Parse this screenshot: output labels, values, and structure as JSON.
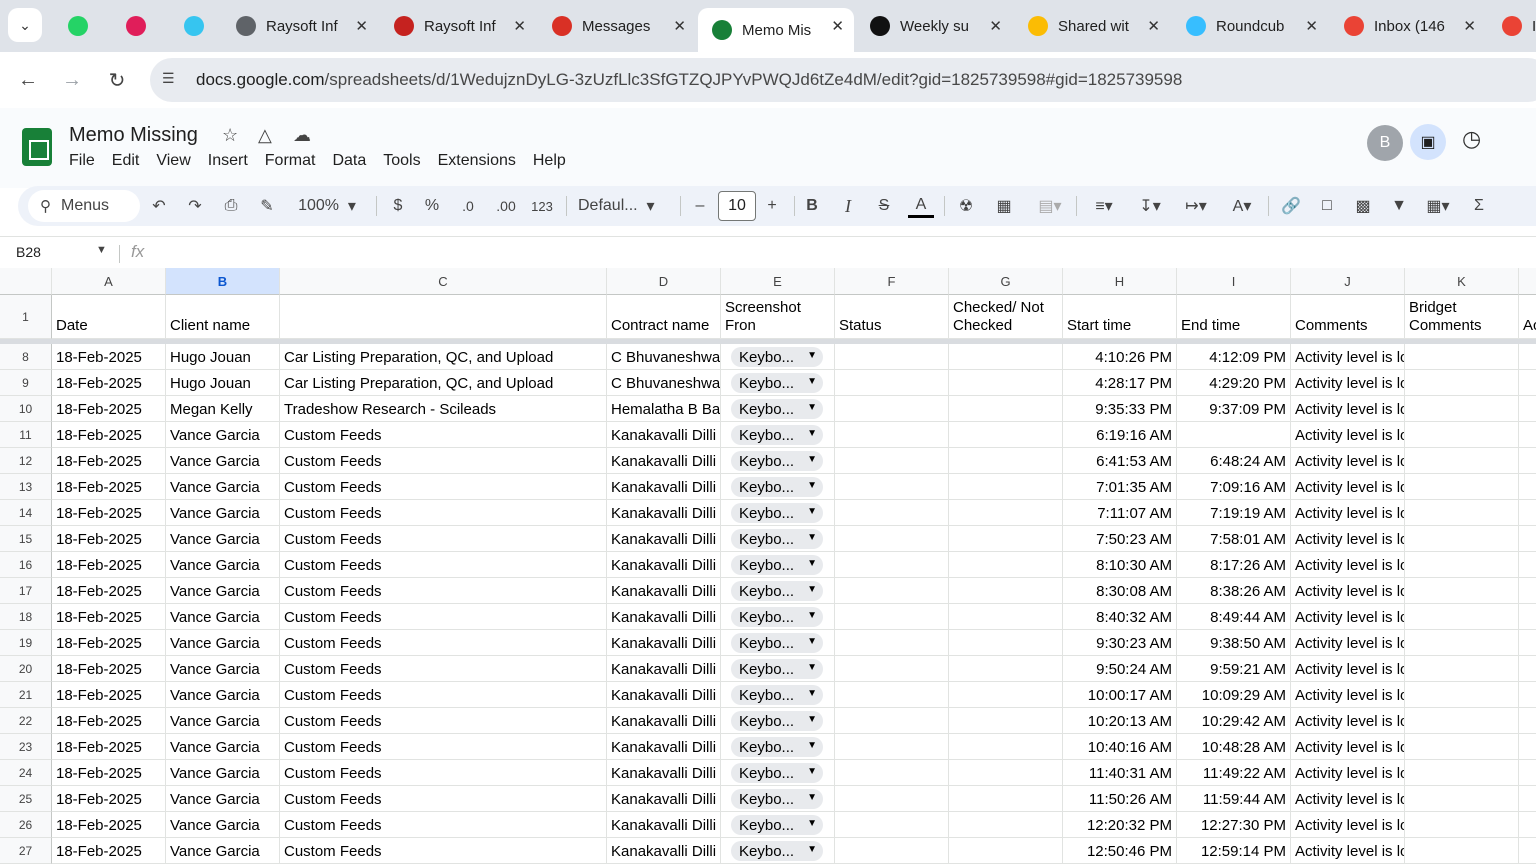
{
  "browser": {
    "tabs": [
      {
        "title": "",
        "icon": "whatsapp-icon",
        "color": "#25d366"
      },
      {
        "title": "",
        "icon": "slack-icon",
        "color": "#e01e5a"
      },
      {
        "title": "",
        "icon": "slack-icon",
        "color": "#36c5f0"
      },
      {
        "title": "Raysoft Inf",
        "icon": "globe-icon",
        "color": "#5f6368"
      },
      {
        "title": "Raysoft Inf",
        "icon": "raysoft-icon",
        "color": "#c5221f"
      },
      {
        "title": "Messages",
        "icon": "messages-icon",
        "color": "#d93025"
      },
      {
        "title": "Memo Mis",
        "icon": "sheets-icon",
        "color": "#188038"
      },
      {
        "title": "Weekly su",
        "icon": "upwork-icon",
        "color": "#111111"
      },
      {
        "title": "Shared wit",
        "icon": "drive-icon",
        "color": "#fbbc04"
      },
      {
        "title": "Roundcub",
        "icon": "roundcube-icon",
        "color": "#37beff"
      },
      {
        "title": "Inbox (146",
        "icon": "gmail-icon",
        "color": "#ea4335"
      },
      {
        "title": "In",
        "icon": "gmail-icon",
        "color": "#ea4335"
      }
    ],
    "url_domain": "docs.google.com",
    "url_path": "/spreadsheets/d/1WedujznDyLG-3zUzfLlc3SfGTZQJPYvPWQJd6tZe4dM/edit?gid=1825739598#gid=1825739598"
  },
  "doc": {
    "title": "Memo Missing",
    "menu": [
      "File",
      "Edit",
      "View",
      "Insert",
      "Format",
      "Data",
      "Tools",
      "Extensions",
      "Help"
    ],
    "avatar_letter": "B"
  },
  "toolbar": {
    "search_label": "Menus",
    "zoom": "100%",
    "currency": "$",
    "percent": "%",
    "dec_decrease": ".0",
    "dec_increase": ".00",
    "number_format": "123",
    "font": "Defaul...",
    "font_size": "10",
    "bold": "B",
    "italic": "I"
  },
  "formula_bar": {
    "cell_ref": "B28",
    "fx": "fx"
  },
  "sheet": {
    "columns": [
      "A",
      "B",
      "C",
      "D",
      "E",
      "F",
      "G",
      "H",
      "I",
      "J",
      "K"
    ],
    "header_row_num": "1",
    "headers": [
      "Date",
      "Client name",
      "",
      "Contract name",
      "Screenshot Fron",
      "Status",
      "Checked/ Not Checked",
      "Start time",
      "End time",
      "Comments",
      "Bridget Comments",
      "Ac"
    ],
    "rows": [
      {
        "n": "8",
        "date": "18-Feb-2025",
        "client": "Hugo Jouan",
        "task": "Car Listing Preparation, QC, and Upload",
        "contract": "C Bhuvaneshwa",
        "chip": "Keybo...",
        "start": "4:10:26 PM",
        "end": "4:12:09 PM",
        "comment": "Activity level is lo"
      },
      {
        "n": "9",
        "date": "18-Feb-2025",
        "client": "Hugo Jouan",
        "task": "Car Listing Preparation, QC, and Upload",
        "contract": "C Bhuvaneshwa",
        "chip": "Keybo...",
        "start": "4:28:17 PM",
        "end": "4:29:20 PM",
        "comment": "Activity level is lo"
      },
      {
        "n": "10",
        "date": "18-Feb-2025",
        "client": "Megan Kelly",
        "task": "Tradeshow Research - Scileads",
        "contract": "Hemalatha B Ba",
        "chip": "Keybo...",
        "start": "9:35:33 PM",
        "end": "9:37:09 PM",
        "comment": "Activity level is lo"
      },
      {
        "n": "11",
        "date": "18-Feb-2025",
        "client": "Vance Garcia",
        "task": "Custom Feeds",
        "contract": "Kanakavalli Dilli",
        "chip": "Keybo...",
        "start": "6:19:16 AM",
        "end": "",
        "comment": "Activity level is lo"
      },
      {
        "n": "12",
        "date": "18-Feb-2025",
        "client": "Vance Garcia",
        "task": "Custom Feeds",
        "contract": "Kanakavalli Dilli",
        "chip": "Keybo...",
        "start": "6:41:53 AM",
        "end": "6:48:24 AM",
        "comment": "Activity level is lo"
      },
      {
        "n": "13",
        "date": "18-Feb-2025",
        "client": "Vance Garcia",
        "task": "Custom Feeds",
        "contract": "Kanakavalli Dilli",
        "chip": "Keybo...",
        "start": "7:01:35 AM",
        "end": "7:09:16 AM",
        "comment": "Activity level is lo"
      },
      {
        "n": "14",
        "date": "18-Feb-2025",
        "client": "Vance Garcia",
        "task": "Custom Feeds",
        "contract": "Kanakavalli Dilli",
        "chip": "Keybo...",
        "start": "7:11:07 AM",
        "end": "7:19:19 AM",
        "comment": "Activity level is lo"
      },
      {
        "n": "15",
        "date": "18-Feb-2025",
        "client": "Vance Garcia",
        "task": "Custom Feeds",
        "contract": "Kanakavalli Dilli",
        "chip": "Keybo...",
        "start": "7:50:23 AM",
        "end": "7:58:01 AM",
        "comment": "Activity level is lo"
      },
      {
        "n": "16",
        "date": "18-Feb-2025",
        "client": "Vance Garcia",
        "task": "Custom Feeds",
        "contract": "Kanakavalli Dilli",
        "chip": "Keybo...",
        "start": "8:10:30 AM",
        "end": "8:17:26 AM",
        "comment": "Activity level is lo"
      },
      {
        "n": "17",
        "date": "18-Feb-2025",
        "client": "Vance Garcia",
        "task": "Custom Feeds",
        "contract": "Kanakavalli Dilli",
        "chip": "Keybo...",
        "start": "8:30:08 AM",
        "end": "8:38:26 AM",
        "comment": "Activity level is lo"
      },
      {
        "n": "18",
        "date": "18-Feb-2025",
        "client": "Vance Garcia",
        "task": "Custom Feeds",
        "contract": "Kanakavalli Dilli",
        "chip": "Keybo...",
        "start": "8:40:32 AM",
        "end": "8:49:44 AM",
        "comment": "Activity level is lo"
      },
      {
        "n": "19",
        "date": "18-Feb-2025",
        "client": "Vance Garcia",
        "task": "Custom Feeds",
        "contract": "Kanakavalli Dilli",
        "chip": "Keybo...",
        "start": "9:30:23 AM",
        "end": "9:38:50 AM",
        "comment": "Activity level is lo"
      },
      {
        "n": "20",
        "date": "18-Feb-2025",
        "client": "Vance Garcia",
        "task": "Custom Feeds",
        "contract": "Kanakavalli Dilli",
        "chip": "Keybo...",
        "start": "9:50:24 AM",
        "end": "9:59:21 AM",
        "comment": "Activity level is lo"
      },
      {
        "n": "21",
        "date": "18-Feb-2025",
        "client": "Vance Garcia",
        "task": "Custom Feeds",
        "contract": "Kanakavalli Dilli",
        "chip": "Keybo...",
        "start": "10:00:17 AM",
        "end": "10:09:29 AM",
        "comment": "Activity level is lo"
      },
      {
        "n": "22",
        "date": "18-Feb-2025",
        "client": "Vance Garcia",
        "task": "Custom Feeds",
        "contract": "Kanakavalli Dilli",
        "chip": "Keybo...",
        "start": "10:20:13 AM",
        "end": "10:29:42 AM",
        "comment": "Activity level is lo"
      },
      {
        "n": "23",
        "date": "18-Feb-2025",
        "client": "Vance Garcia",
        "task": "Custom Feeds",
        "contract": "Kanakavalli Dilli",
        "chip": "Keybo...",
        "start": "10:40:16 AM",
        "end": "10:48:28 AM",
        "comment": "Activity level is lo"
      },
      {
        "n": "24",
        "date": "18-Feb-2025",
        "client": "Vance Garcia",
        "task": "Custom Feeds",
        "contract": "Kanakavalli Dilli",
        "chip": "Keybo...",
        "start": "11:40:31 AM",
        "end": "11:49:22 AM",
        "comment": "Activity level is lo"
      },
      {
        "n": "25",
        "date": "18-Feb-2025",
        "client": "Vance Garcia",
        "task": "Custom Feeds",
        "contract": "Kanakavalli Dilli",
        "chip": "Keybo...",
        "start": "11:50:26 AM",
        "end": "11:59:44 AM",
        "comment": "Activity level is lo"
      },
      {
        "n": "26",
        "date": "18-Feb-2025",
        "client": "Vance Garcia",
        "task": "Custom Feeds",
        "contract": "Kanakavalli Dilli",
        "chip": "Keybo...",
        "start": "12:20:32 PM",
        "end": "12:27:30 PM",
        "comment": "Activity level is lo"
      },
      {
        "n": "27",
        "date": "18-Feb-2025",
        "client": "Vance Garcia",
        "task": "Custom Feeds",
        "contract": "Kanakavalli Dilli",
        "chip": "Keybo...",
        "start": "12:50:46 PM",
        "end": "12:59:14 PM",
        "comment": "Activity level is lo"
      }
    ]
  }
}
